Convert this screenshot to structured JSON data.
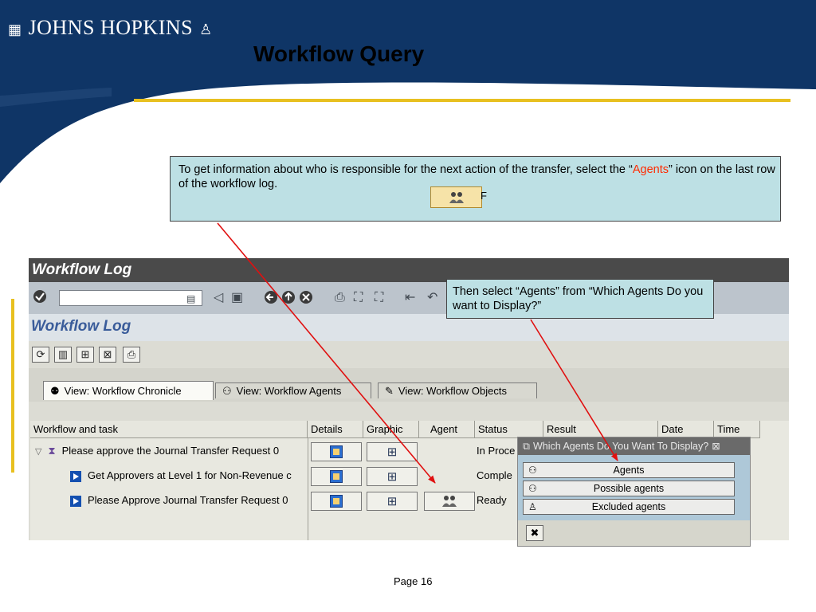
{
  "slide": {
    "logo_text": "JOHNS HOPKINS",
    "title": "Workflow Query",
    "page_label": "Page 16",
    "callout1": {
      "text_part1": "To get information about who is responsible for the next action of the transfer, select the “",
      "text_highlight": "Agents",
      "text_part2": "” icon on the last row of the workflow log.",
      "icon_tail": "F"
    },
    "callout2": {
      "text": "Then select “Agents” from “Which Agents Do you want to Display?”"
    },
    "colors": {
      "banner": "#0f3566",
      "gold": "#e8c020",
      "callout_bg": "#bde0e4",
      "highlight": "#ff2a00",
      "arrow": "#e01010"
    }
  },
  "sap": {
    "window_title": "Workflow Log",
    "screen_title": "Workflow Log",
    "command_field": {
      "value": ""
    },
    "toolbar_icons": [
      "enter-icon",
      "back-icon",
      "save-icon",
      "back-arrow-icon",
      "exit-icon",
      "cancel-icon",
      "print-icon",
      "find-icon",
      "find-next-icon",
      "first-page-icon",
      "previous-page-icon"
    ],
    "app_toolbar_icons": [
      "refresh-icon",
      "layout-icon",
      "hierarchy-icon",
      "legend-icon",
      "print-icon"
    ],
    "tabs": [
      {
        "label": "View: Workflow Chronicle",
        "icon": "chronicle-icon",
        "active": true
      },
      {
        "label": "View: Workflow Agents",
        "icon": "agents-icon",
        "active": false
      },
      {
        "label": "View: Workflow Objects",
        "icon": "objects-icon",
        "active": false
      }
    ],
    "columns": [
      "Workflow and task",
      "Details",
      "Graphic",
      "Agent",
      "Status",
      "Result",
      "Date",
      "Time"
    ],
    "rows": [
      {
        "task": "Please approve the Journal Transfer Request 0",
        "status": "In Proce",
        "has_agent": false
      },
      {
        "task": "Get Approvers at Level 1 for Non-Revenue c",
        "status": "Comple",
        "has_agent": false
      },
      {
        "task": "Please Approve Journal Transfer Request 0",
        "status": "Ready",
        "has_agent": true
      }
    ],
    "popup": {
      "title": "Which Agents Do You Want To Display?",
      "options": [
        {
          "label": "Agents",
          "icon": "agent-icon"
        },
        {
          "label": "Possible agents",
          "icon": "possible-agents-icon"
        },
        {
          "label": "Excluded agents",
          "icon": "excluded-agent-icon"
        }
      ],
      "close_icon": "cancel-icon"
    }
  }
}
